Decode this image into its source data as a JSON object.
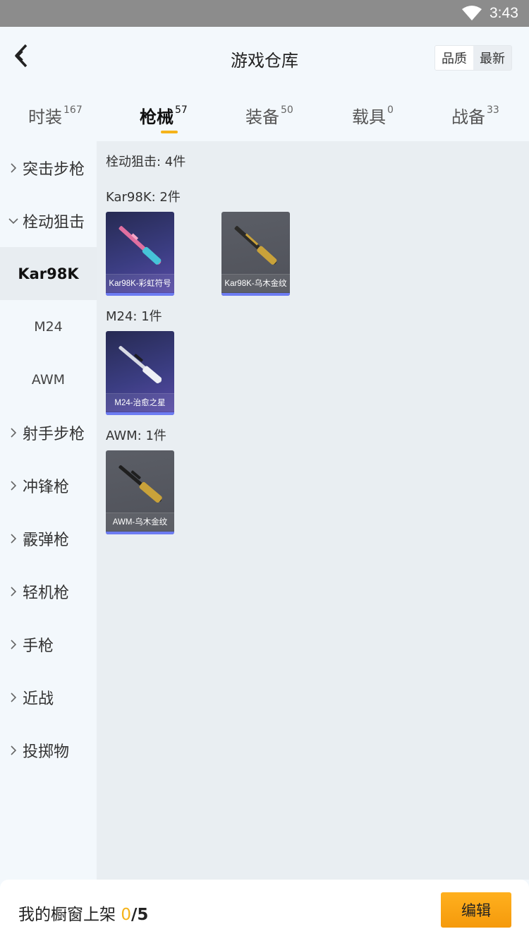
{
  "status_bar": {
    "time": "3:43",
    "wifi_icon": "wifi-icon"
  },
  "header": {
    "title": "游戏仓库",
    "back_icon": "chevron-left-icon",
    "sort_options": [
      "品质",
      "最新"
    ]
  },
  "tabs": [
    {
      "label": "时装",
      "count": "167"
    },
    {
      "label": "枪械",
      "count": "57"
    },
    {
      "label": "装备",
      "count": "50"
    },
    {
      "label": "载具",
      "count": "0"
    },
    {
      "label": "战备",
      "count": "33"
    }
  ],
  "active_tab": "枪械",
  "sidebar": {
    "items": [
      {
        "label": "突击步枪",
        "type": "category",
        "expanded": false
      },
      {
        "label": "栓动狙击",
        "type": "category",
        "expanded": true
      },
      {
        "label": "Kar98K",
        "type": "sub",
        "selected": true
      },
      {
        "label": "M24",
        "type": "sub",
        "selected": false
      },
      {
        "label": "AWM",
        "type": "sub",
        "selected": false
      },
      {
        "label": "射手步枪",
        "type": "category",
        "expanded": false
      },
      {
        "label": "冲锋枪",
        "type": "category",
        "expanded": false
      },
      {
        "label": "霰弹枪",
        "type": "category",
        "expanded": false
      },
      {
        "label": "轻机枪",
        "type": "category",
        "expanded": false
      },
      {
        "label": "手枪",
        "type": "category",
        "expanded": false
      },
      {
        "label": "近战",
        "type": "category",
        "expanded": false
      },
      {
        "label": "投掷物",
        "type": "category",
        "expanded": false
      }
    ]
  },
  "content": {
    "summary": "栓动狙击: 4件",
    "groups": [
      {
        "title": "Kar98K: 2件",
        "items": [
          {
            "name": "Kar98K-彩虹符号",
            "style": "purple",
            "gun_color": "#d9709a"
          },
          {
            "name": "Kar98K-乌木金纹",
            "style": "grey",
            "gun_color": "#c9a23a"
          }
        ]
      },
      {
        "title": "M24: 1件",
        "items": [
          {
            "name": "M24-治愈之星",
            "style": "purple",
            "gun_color": "#d8dbe4"
          }
        ]
      },
      {
        "title": "AWM: 1件",
        "items": [
          {
            "name": "AWM-乌木金纹",
            "style": "grey",
            "gun_color": "#c9a23a"
          }
        ]
      }
    ]
  },
  "bottom_bar": {
    "label": "我的橱窗上架",
    "current": "0",
    "separator": "/",
    "max": "5",
    "edit_button": "编辑"
  },
  "colors": {
    "accent": "#f5b31a",
    "card_bar": "#6d7cf2",
    "background": "#f3f8fc",
    "content_bg": "#e9eef2"
  }
}
